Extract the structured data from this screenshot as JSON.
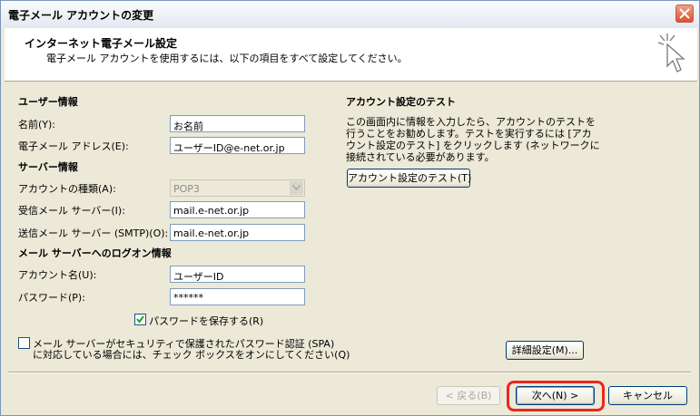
{
  "window": {
    "title": "電子メール アカウントの変更"
  },
  "header": {
    "title": "インターネット電子メール設定",
    "subtitle": "電子メール アカウントを使用するには、以下の項目をすべて設定してください。"
  },
  "user_info": {
    "heading": "ユーザー情報",
    "name_label": "名前(Y):",
    "name_value": "お名前",
    "email_label": "電子メール アドレス(E):",
    "email_value": "ユーザーID@e-net.or.jp"
  },
  "server_info": {
    "heading": "サーバー情報",
    "account_type_label": "アカウントの種類(A):",
    "account_type_value": "POP3",
    "incoming_label": "受信メール サーバー(I):",
    "incoming_value": "mail.e-net.or.jp",
    "outgoing_label": "送信メール サーバー (SMTP)(O):",
    "outgoing_value": "mail.e-net.or.jp"
  },
  "logon_info": {
    "heading": "メール サーバーへのログオン情報",
    "account_name_label": "アカウント名(U):",
    "account_name_value": "ユーザーID",
    "password_label": "パスワード(P):",
    "password_value": "******",
    "save_password_label": "パスワードを保存する(R)",
    "save_password_checked": true,
    "spa_label_line1": "メール サーバーがセキュリティで保護されたパスワード認証 (SPA)",
    "spa_label_line2": "に対応している場合には、チェック ボックスをオンにしてください(Q)",
    "spa_checked": false
  },
  "test": {
    "heading": "アカウント設定のテスト",
    "description": "この画面内に情報を入力したら、アカウントのテストを行うことをお勧めします。テストを実行するには [アカウント設定のテスト] をクリックします (ネットワークに接続されている必要があります。",
    "button_label": "アカウント設定のテスト(T)"
  },
  "advanced_button_label": "詳細設定(M)...",
  "footer": {
    "back_label": "< 戻る(B)",
    "next_label": "次へ(N) >",
    "cancel_label": "キャンセル"
  },
  "colors": {
    "highlight": "#e8281e",
    "title_close": "#d8532f"
  }
}
